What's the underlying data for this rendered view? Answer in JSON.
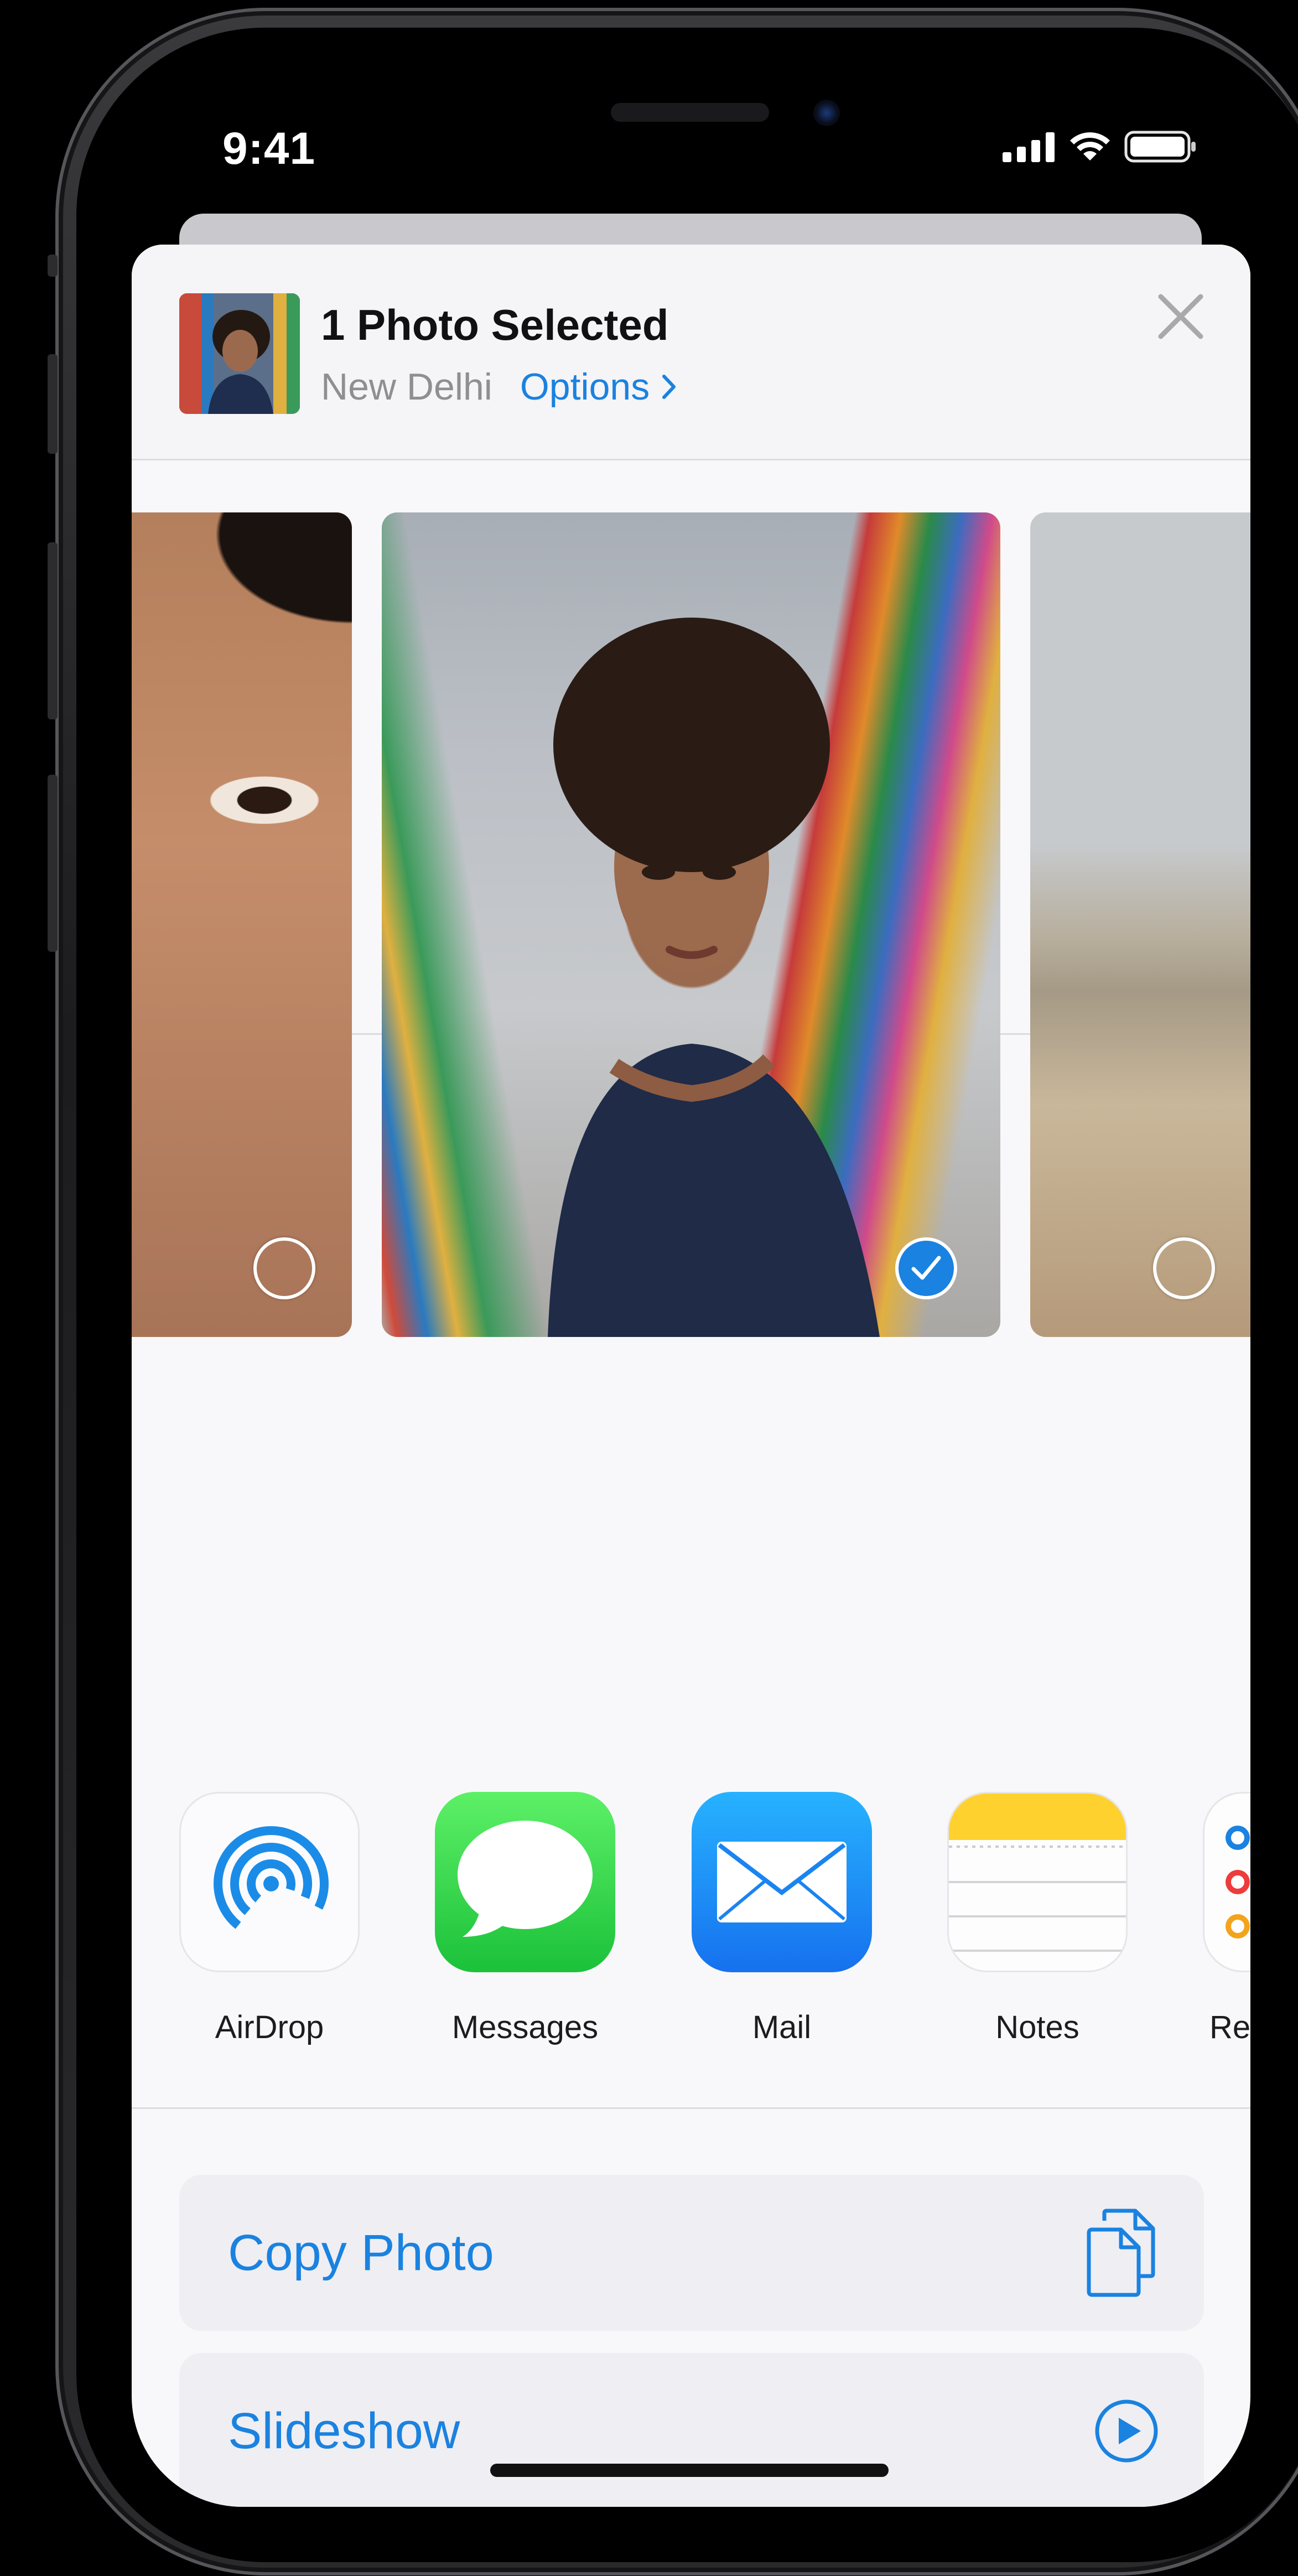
{
  "status_bar": {
    "time": "9:41"
  },
  "share_sheet": {
    "title": "1 Photo Selected",
    "location": "New Delhi",
    "options_label": "Options"
  },
  "photos": [
    {
      "selected": false
    },
    {
      "selected": true
    },
    {
      "selected": false
    }
  ],
  "apps": [
    {
      "label": "AirDrop",
      "icon": "airdrop-icon"
    },
    {
      "label": "Messages",
      "icon": "messages-icon"
    },
    {
      "label": "Mail",
      "icon": "mail-icon"
    },
    {
      "label": "Notes",
      "icon": "notes-icon"
    },
    {
      "label": "Re",
      "icon": "reminders-icon"
    }
  ],
  "actions": [
    {
      "label": "Copy Photo",
      "icon": "copy-icon"
    },
    {
      "label": "Slideshow",
      "icon": "play-icon"
    }
  ],
  "colors": {
    "accent": "#1a82e0"
  }
}
